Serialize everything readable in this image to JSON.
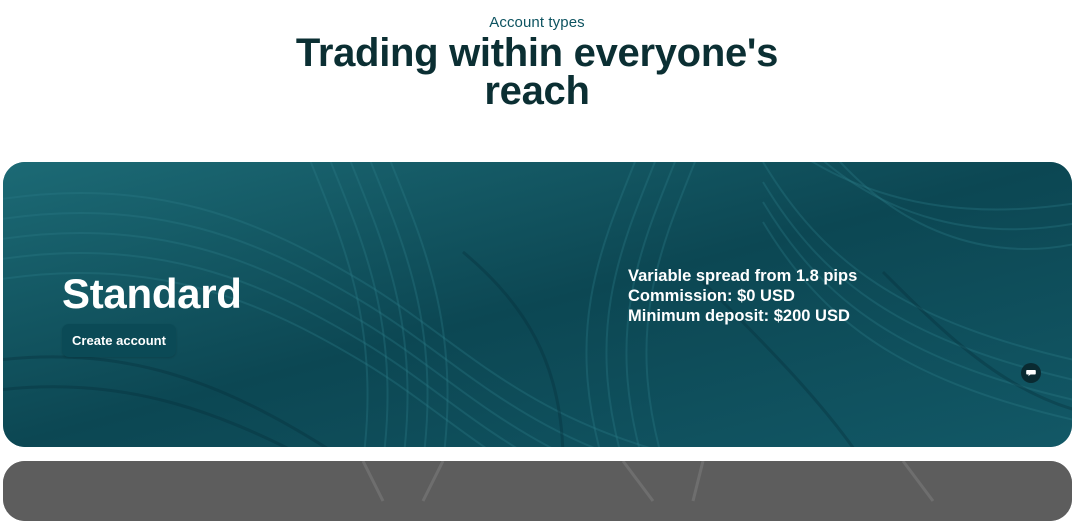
{
  "header": {
    "eyebrow": "Account types",
    "headline": "Trading within everyone's reach"
  },
  "accounts": [
    {
      "name": "Standard",
      "cta_label": "Create account",
      "details": [
        "Variable spread from 1.8 pips",
        "Commission: $0 USD",
        "Minimum deposit: $200 USD"
      ],
      "bg_color": "#0f4f5c"
    },
    {
      "bg_color": "#5b5b5b"
    }
  ],
  "chat": {
    "icon": "chat-bubble-icon"
  },
  "colors": {
    "accent": "#0d5360",
    "headline": "#0b2f33",
    "button": "#0b4a56"
  }
}
